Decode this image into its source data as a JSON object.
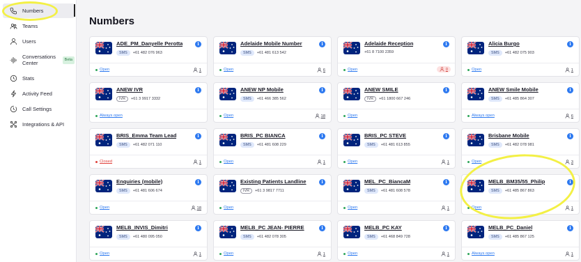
{
  "sidebar": {
    "items": [
      {
        "label": "Numbers",
        "icon": "phone-icon",
        "active": true
      },
      {
        "label": "Teams",
        "icon": "teams-icon"
      },
      {
        "label": "Users",
        "icon": "user-icon"
      },
      {
        "label": "Conversations Center",
        "icon": "waveform-icon",
        "badge": "Beta"
      },
      {
        "label": "Stats",
        "icon": "clock-icon"
      },
      {
        "label": "Activity Feed",
        "icon": "bolt-icon"
      },
      {
        "label": "Call Settings",
        "icon": "settings-clock-icon"
      },
      {
        "label": "Integrations & API",
        "icon": "integrations-icon"
      }
    ]
  },
  "page": {
    "title": "Numbers"
  },
  "colors": {
    "accent": "#2d79f0",
    "open": "#2fa55a",
    "closed": "#e0413b",
    "highlight": "#f3f045"
  },
  "cards": [
    {
      "name": "ADE_PM_Danyelle Perotta",
      "type": "SMS",
      "number": "+61 482 076 963",
      "status": "Open",
      "status_kind": "open",
      "users": "1"
    },
    {
      "name": "Adelaide Mobile Number",
      "type": "SMS",
      "number": "+61 481 613 542",
      "status": "Open",
      "status_kind": "open",
      "users": "6"
    },
    {
      "name": "Adelaide Reception",
      "type": "",
      "number": "+61 8 7100 2359",
      "status": "Open",
      "status_kind": "open",
      "users": "0",
      "users_warn": true
    },
    {
      "name": "Alicia Burgo",
      "type": "SMS",
      "number": "+61 482 075 903",
      "status": "Open",
      "status_kind": "open",
      "users": "1"
    },
    {
      "name": "ANEW IVR",
      "type": "IVR",
      "number": "+61 3 9917 3332",
      "status": "Always open",
      "status_kind": "open",
      "users": ""
    },
    {
      "name": "ANEW NP Mobile",
      "type": "SMS",
      "number": "+61 466 385 562",
      "status": "Open",
      "status_kind": "open",
      "users": "18"
    },
    {
      "name": "ANEW SMILE",
      "type": "IVR",
      "number": "+61 1800 667 246",
      "status": "Open",
      "status_kind": "open",
      "users": ""
    },
    {
      "name": "ANEW Smile Mobile",
      "type": "SMS",
      "number": "+61 485 864 307",
      "status": "Always open",
      "status_kind": "open",
      "users": "6"
    },
    {
      "name": "BRIS_Emma Team Lead",
      "type": "SMS",
      "number": "+61 482 071 110",
      "status": "Closed",
      "status_kind": "closed",
      "users": "1"
    },
    {
      "name": "BRIS_PC BIANCA",
      "type": "SMS",
      "number": "+61 481 608 229",
      "status": "Open",
      "status_kind": "open",
      "users": "1"
    },
    {
      "name": "BRIS_PC STEVE",
      "type": "SMS",
      "number": "+61 481 613 855",
      "status": "Open",
      "status_kind": "open",
      "users": "1"
    },
    {
      "name": "Brisbane Mobile",
      "type": "SMS",
      "number": "+61 482 078 981",
      "status": "Open",
      "status_kind": "open",
      "users": "3"
    },
    {
      "name": "Enquiries (mobile)",
      "type": "SMS",
      "number": "+61 481 606 674",
      "status": "Open",
      "status_kind": "open",
      "users": "18"
    },
    {
      "name": "Existing Patients Landline",
      "type": "IVR",
      "number": "+61 3 9817 7711",
      "status": "Open",
      "status_kind": "open",
      "users": ""
    },
    {
      "name": "MEL_PC_BiancaM",
      "type": "SMS",
      "number": "+61 481 608 578",
      "status": "Open",
      "status_kind": "open",
      "users": "1"
    },
    {
      "name": "MELB_BM35/55_Philip",
      "type": "SMS",
      "number": "+61 485 867 863",
      "status": "Open",
      "status_kind": "open",
      "users": "1"
    },
    {
      "name": "MELB_INVIS_Dimitri",
      "type": "SMS",
      "number": "+61 480 095 050",
      "status": "Open",
      "status_kind": "open",
      "users": "1"
    },
    {
      "name": "MELB_PC JEAN- PIERRE",
      "type": "SMS",
      "number": "+61 482 078 305",
      "status": "Open",
      "status_kind": "open",
      "users": "1"
    },
    {
      "name": "MELB_PC KAY",
      "type": "SMS",
      "number": "+61 468 849 728",
      "status": "Open",
      "status_kind": "open",
      "users": "1"
    },
    {
      "name": "MELB_PC_Daniel",
      "type": "SMS",
      "number": "+61 485 867 125",
      "status": "Always open",
      "status_kind": "open",
      "users": "1"
    }
  ]
}
